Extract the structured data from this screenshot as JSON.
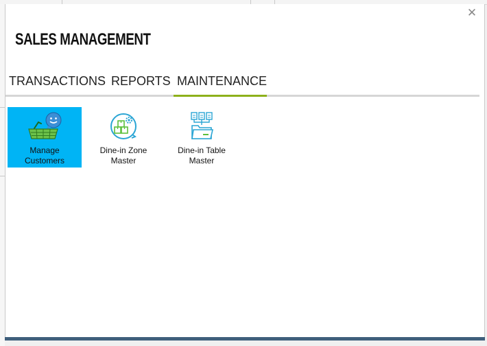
{
  "window": {
    "title": "SALES MANAGEMENT",
    "close_glyph": "✕"
  },
  "tabs": [
    {
      "label": "TRANSACTIONS",
      "active": false
    },
    {
      "label": "REPORTS",
      "active": false
    },
    {
      "label": "MAINTENANCE",
      "active": true
    }
  ],
  "tiles": [
    {
      "line1": "Manage",
      "line2": "Customers",
      "icon": "manage-customers-icon",
      "selected": true
    },
    {
      "line1": "Dine-in Zone",
      "line2": "Master",
      "icon": "dine-in-zone-icon",
      "selected": false
    },
    {
      "line1": "Dine-in Table",
      "line2": "Master",
      "icon": "dine-in-table-icon",
      "selected": false
    }
  ],
  "colors": {
    "selected_tile": "#00b4f5",
    "active_tab_bar": "#8db01a",
    "tab_track": "#d6d6d6",
    "bottom_border": "#3f5f7c"
  }
}
